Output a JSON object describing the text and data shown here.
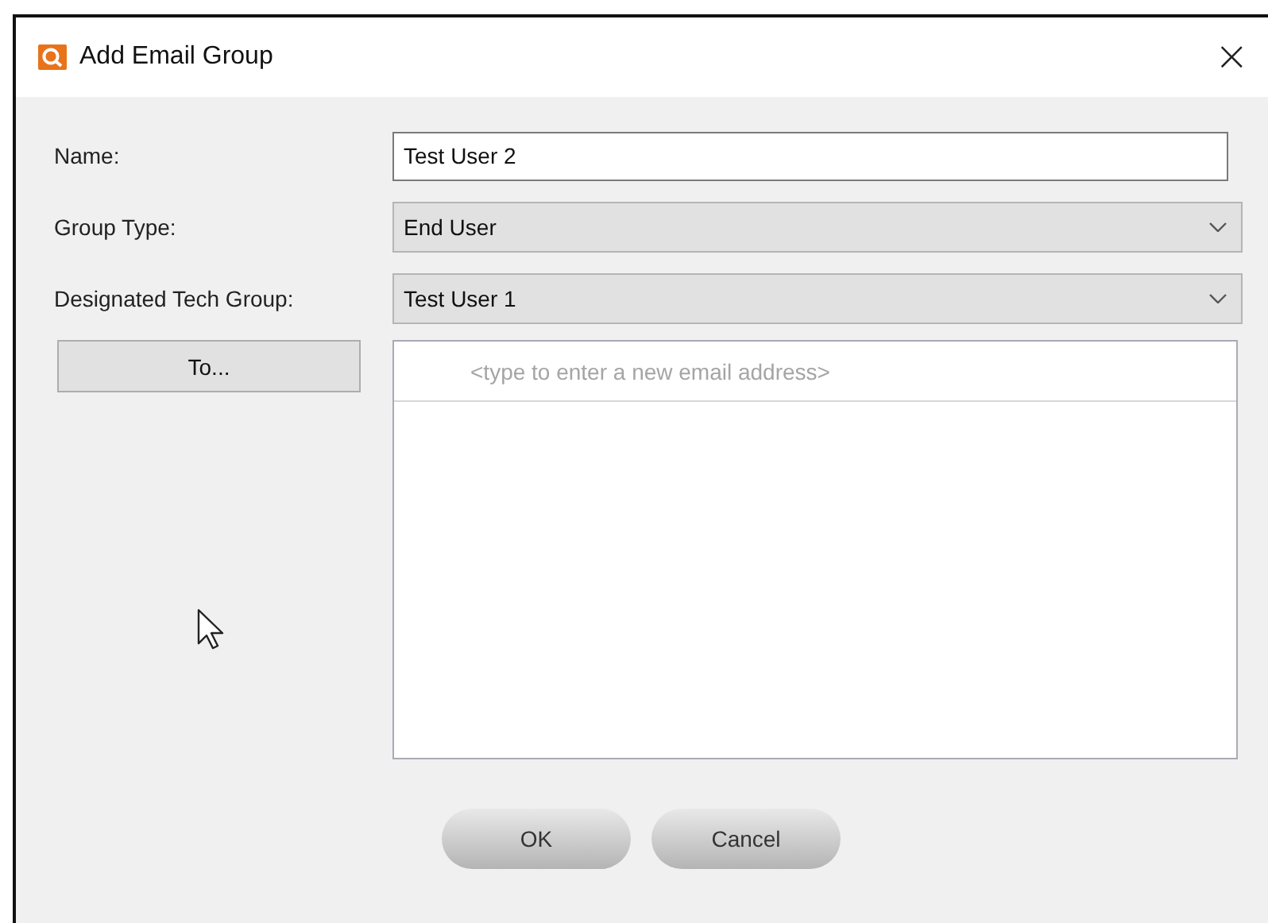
{
  "window": {
    "title": "Add Email Group",
    "close": "×"
  },
  "fields": [
    {
      "kind": "text",
      "label": "Name:",
      "value": "Test User 2"
    },
    {
      "kind": "dropdown",
      "label": "Group Type:",
      "value": "End User"
    },
    {
      "kind": "dropdown",
      "label": "Designated Tech Group:",
      "value": "Test User 1"
    }
  ],
  "recipients": {
    "button": "To...",
    "placeholder": "<type to enter a new email address>"
  },
  "buttons": [
    "OK",
    "Cancel"
  ]
}
